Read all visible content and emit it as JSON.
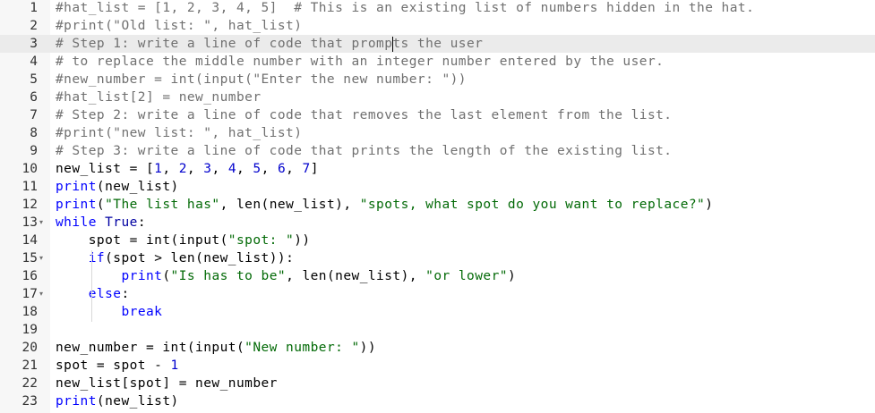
{
  "editor": {
    "active_line": 3,
    "cursor": {
      "line": 3,
      "column": 41
    },
    "colors": {
      "comment": "#707070",
      "keyword": "#0000ff",
      "builtin": "#0000a2",
      "string": "#036a07",
      "number": "#0000cd",
      "default": "#000000",
      "gutter_bg": "#f7f7f7",
      "active_line_bg": "#ebebeb"
    },
    "lines": [
      {
        "n": "1",
        "fold": false,
        "tokens": [
          [
            "c",
            "#hat_list = [1, 2, 3, 4, 5]  # This is an existing list of numbers hidden in the hat."
          ]
        ]
      },
      {
        "n": "2",
        "fold": false,
        "tokens": [
          [
            "c",
            "#print(\"Old list: \", hat_list)"
          ]
        ]
      },
      {
        "n": "3",
        "fold": false,
        "tokens": [
          [
            "c",
            "# Step 1: write a line of code that prompts the user"
          ]
        ]
      },
      {
        "n": "4",
        "fold": false,
        "tokens": [
          [
            "c",
            "# to replace the middle number with an integer number entered by the user."
          ]
        ]
      },
      {
        "n": "5",
        "fold": false,
        "tokens": [
          [
            "c",
            "#new_number = int(input(\"Enter the new number: \"))"
          ]
        ]
      },
      {
        "n": "6",
        "fold": false,
        "tokens": [
          [
            "c",
            "#hat_list[2] = new_number"
          ]
        ]
      },
      {
        "n": "7",
        "fold": false,
        "tokens": [
          [
            "c",
            "# Step 2: write a line of code that removes the last element from the list."
          ]
        ]
      },
      {
        "n": "8",
        "fold": false,
        "tokens": [
          [
            "c",
            "#print(\"new list: \", hat_list)"
          ]
        ]
      },
      {
        "n": "9",
        "fold": false,
        "tokens": [
          [
            "c",
            "# Step 3: write a line of code that prints the length of the existing list."
          ]
        ]
      },
      {
        "n": "10",
        "fold": false,
        "tokens": [
          [
            "d",
            "new_list = ["
          ],
          [
            "n",
            "1"
          ],
          [
            "d",
            ", "
          ],
          [
            "n",
            "2"
          ],
          [
            "d",
            ", "
          ],
          [
            "n",
            "3"
          ],
          [
            "d",
            ", "
          ],
          [
            "n",
            "4"
          ],
          [
            "d",
            ", "
          ],
          [
            "n",
            "5"
          ],
          [
            "d",
            ", "
          ],
          [
            "n",
            "6"
          ],
          [
            "d",
            ", "
          ],
          [
            "n",
            "7"
          ],
          [
            "d",
            "]"
          ]
        ]
      },
      {
        "n": "11",
        "fold": false,
        "tokens": [
          [
            "k",
            "print"
          ],
          [
            "d",
            "(new_list)"
          ]
        ]
      },
      {
        "n": "12",
        "fold": false,
        "tokens": [
          [
            "k",
            "print"
          ],
          [
            "d",
            "("
          ],
          [
            "s",
            "\"The list has\""
          ],
          [
            "d",
            ", len(new_list), "
          ],
          [
            "s",
            "\"spots, what spot do you want to replace?\""
          ],
          [
            "d",
            ")"
          ]
        ]
      },
      {
        "n": "13",
        "fold": true,
        "tokens": [
          [
            "k",
            "while"
          ],
          [
            "d",
            " "
          ],
          [
            "b",
            "True"
          ],
          [
            "d",
            ":"
          ]
        ]
      },
      {
        "n": "14",
        "fold": false,
        "tokens": [
          [
            "d",
            "    spot = int(input("
          ],
          [
            "s",
            "\"spot: \""
          ],
          [
            "d",
            "))"
          ]
        ]
      },
      {
        "n": "15",
        "fold": true,
        "tokens": [
          [
            "d",
            "    "
          ],
          [
            "k",
            "if"
          ],
          [
            "d",
            "(spot > len(new_list)):"
          ]
        ]
      },
      {
        "n": "16",
        "fold": false,
        "tokens": [
          [
            "d",
            "        "
          ],
          [
            "k",
            "print"
          ],
          [
            "d",
            "("
          ],
          [
            "s",
            "\"Is has to be\""
          ],
          [
            "d",
            ", len(new_list), "
          ],
          [
            "s",
            "\"or lower\""
          ],
          [
            "d",
            ")"
          ]
        ]
      },
      {
        "n": "17",
        "fold": true,
        "tokens": [
          [
            "d",
            "    "
          ],
          [
            "k",
            "else"
          ],
          [
            "d",
            ":"
          ]
        ]
      },
      {
        "n": "18",
        "fold": false,
        "tokens": [
          [
            "d",
            "        "
          ],
          [
            "k",
            "break"
          ]
        ]
      },
      {
        "n": "19",
        "fold": false,
        "tokens": []
      },
      {
        "n": "20",
        "fold": false,
        "tokens": [
          [
            "d",
            "new_number = int(input("
          ],
          [
            "s",
            "\"New number: \""
          ],
          [
            "d",
            "))"
          ]
        ]
      },
      {
        "n": "21",
        "fold": false,
        "tokens": [
          [
            "d",
            "spot = spot - "
          ],
          [
            "n",
            "1"
          ]
        ]
      },
      {
        "n": "22",
        "fold": false,
        "tokens": [
          [
            "d",
            "new_list[spot] = new_number"
          ]
        ]
      },
      {
        "n": "23",
        "fold": false,
        "tokens": [
          [
            "k",
            "print"
          ],
          [
            "d",
            "(new_list)"
          ]
        ]
      }
    ]
  }
}
